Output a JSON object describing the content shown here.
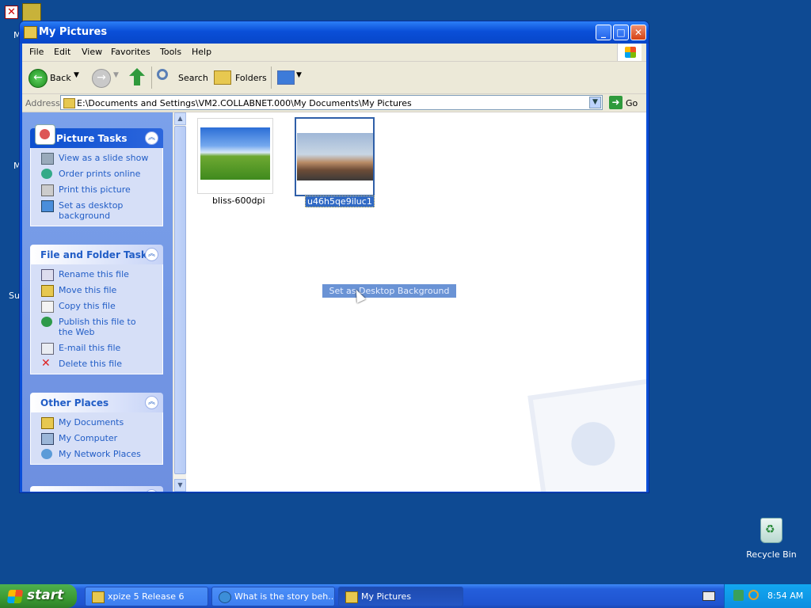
{
  "desktop": {
    "cut_labels": [
      "M",
      "M",
      "Su"
    ],
    "recycle_bin_label": "Recycle Bin"
  },
  "window": {
    "title": "My Pictures",
    "buttons": {
      "minimize": "_",
      "maximize": "□",
      "close": "✕"
    }
  },
  "menubar": {
    "items": [
      "File",
      "Edit",
      "View",
      "Favorites",
      "Tools",
      "Help"
    ]
  },
  "toolbar": {
    "back_label": "Back",
    "search_label": "Search",
    "folders_label": "Folders"
  },
  "address": {
    "label": "Address",
    "value": "E:\\Documents and Settings\\VM2.COLLABNET.000\\My Documents\\My Pictures",
    "go_label": "Go"
  },
  "tasks": {
    "picture_tasks": {
      "title": "Picture Tasks",
      "items": [
        "View as a slide show",
        "Order prints online",
        "Print this picture",
        "Set as desktop background"
      ]
    },
    "file_folder_tasks": {
      "title": "File and Folder Tasks",
      "items": [
        "Rename this file",
        "Move this file",
        "Copy this file",
        "Publish this file to the Web",
        "E-mail this file",
        "Delete this file"
      ]
    },
    "other_places": {
      "title": "Other Places",
      "items": [
        "My Documents",
        "My Computer",
        "My Network Places"
      ]
    }
  },
  "files": [
    {
      "name": "bliss-600dpi",
      "selected": false
    },
    {
      "name": "u46h5qe9iluc1",
      "selected": true
    }
  ],
  "drag_tooltip": "Set as Desktop Background",
  "taskbar": {
    "start_label": "start",
    "buttons": [
      "xpize 5 Release 6",
      "What is the story beh...",
      "My Pictures"
    ],
    "clock": "8:54 AM"
  }
}
